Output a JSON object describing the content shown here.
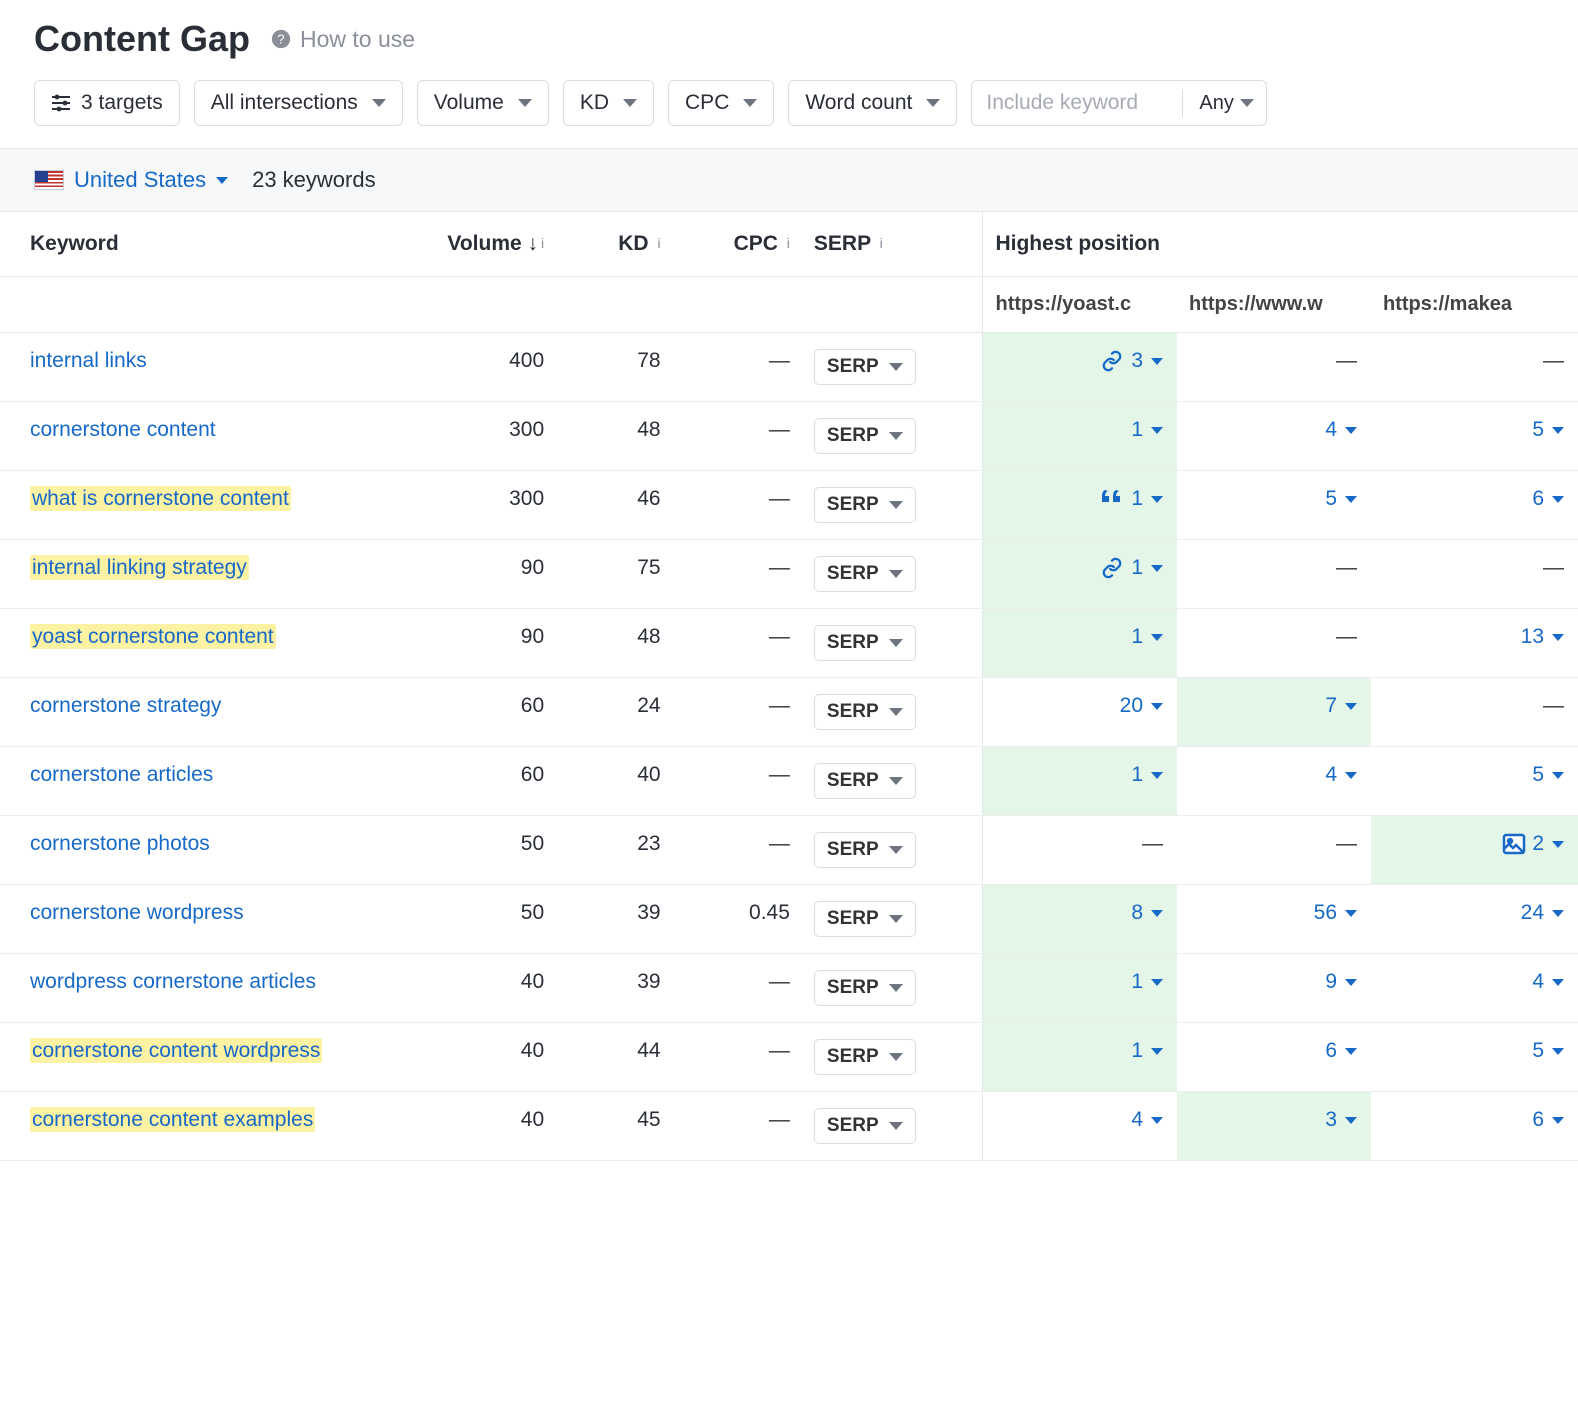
{
  "header": {
    "title": "Content Gap",
    "howto_label": "How to use"
  },
  "filters": {
    "targets_label": "3 targets",
    "intersections_label": "All intersections",
    "volume_label": "Volume",
    "kd_label": "KD",
    "cpc_label": "CPC",
    "wordcount_label": "Word count",
    "include_placeholder": "Include keyword",
    "include_mode": "Any"
  },
  "info_bar": {
    "country": "United States",
    "keywords_count": "23 keywords"
  },
  "columns": {
    "keyword": "Keyword",
    "volume": "Volume",
    "kd": "KD",
    "cpc": "CPC",
    "serp": "SERP",
    "highest_position": "Highest position",
    "serp_button": "SERP"
  },
  "position_domains": [
    "https://yoast.c",
    "https://www.w",
    "https://makea"
  ],
  "rows": [
    {
      "keyword": "internal links",
      "highlight": false,
      "volume": "400",
      "kd": "78",
      "cpc": "—",
      "positions": [
        {
          "value": "3",
          "icon": "link",
          "best": true
        },
        {
          "value": "—"
        },
        {
          "value": "—"
        }
      ]
    },
    {
      "keyword": "cornerstone content",
      "highlight": false,
      "volume": "300",
      "kd": "48",
      "cpc": "—",
      "positions": [
        {
          "value": "1",
          "best": true
        },
        {
          "value": "4"
        },
        {
          "value": "5"
        }
      ]
    },
    {
      "keyword": "what is cornerstone content",
      "highlight": true,
      "volume": "300",
      "kd": "46",
      "cpc": "—",
      "positions": [
        {
          "value": "1",
          "icon": "quote",
          "best": true
        },
        {
          "value": "5"
        },
        {
          "value": "6"
        }
      ]
    },
    {
      "keyword": "internal linking strategy",
      "highlight": true,
      "volume": "90",
      "kd": "75",
      "cpc": "—",
      "positions": [
        {
          "value": "1",
          "icon": "link",
          "best": true
        },
        {
          "value": "—"
        },
        {
          "value": "—"
        }
      ]
    },
    {
      "keyword": "yoast cornerstone content",
      "highlight": true,
      "volume": "90",
      "kd": "48",
      "cpc": "—",
      "positions": [
        {
          "value": "1",
          "best": true
        },
        {
          "value": "—"
        },
        {
          "value": "13"
        }
      ]
    },
    {
      "keyword": "cornerstone strategy",
      "highlight": false,
      "volume": "60",
      "kd": "24",
      "cpc": "—",
      "positions": [
        {
          "value": "20"
        },
        {
          "value": "7",
          "best": true
        },
        {
          "value": "—"
        }
      ]
    },
    {
      "keyword": "cornerstone articles",
      "highlight": false,
      "volume": "60",
      "kd": "40",
      "cpc": "—",
      "positions": [
        {
          "value": "1",
          "best": true
        },
        {
          "value": "4"
        },
        {
          "value": "5"
        }
      ]
    },
    {
      "keyword": "cornerstone photos",
      "highlight": false,
      "volume": "50",
      "kd": "23",
      "cpc": "—",
      "positions": [
        {
          "value": "—"
        },
        {
          "value": "—"
        },
        {
          "value": "2",
          "icon": "image",
          "best": true
        }
      ]
    },
    {
      "keyword": "cornerstone wordpress",
      "highlight": false,
      "volume": "50",
      "kd": "39",
      "cpc": "0.45",
      "positions": [
        {
          "value": "8",
          "best": true
        },
        {
          "value": "56"
        },
        {
          "value": "24"
        }
      ]
    },
    {
      "keyword": "wordpress cornerstone articles",
      "highlight": false,
      "volume": "40",
      "kd": "39",
      "cpc": "—",
      "positions": [
        {
          "value": "1",
          "best": true
        },
        {
          "value": "9"
        },
        {
          "value": "4"
        }
      ]
    },
    {
      "keyword": "cornerstone content wordpress",
      "highlight": true,
      "volume": "40",
      "kd": "44",
      "cpc": "—",
      "positions": [
        {
          "value": "1",
          "best": true
        },
        {
          "value": "6"
        },
        {
          "value": "5"
        }
      ]
    },
    {
      "keyword": "cornerstone content examples",
      "highlight": true,
      "volume": "40",
      "kd": "45",
      "cpc": "—",
      "positions": [
        {
          "value": "4"
        },
        {
          "value": "3",
          "best": true
        },
        {
          "value": "6"
        }
      ]
    }
  ]
}
